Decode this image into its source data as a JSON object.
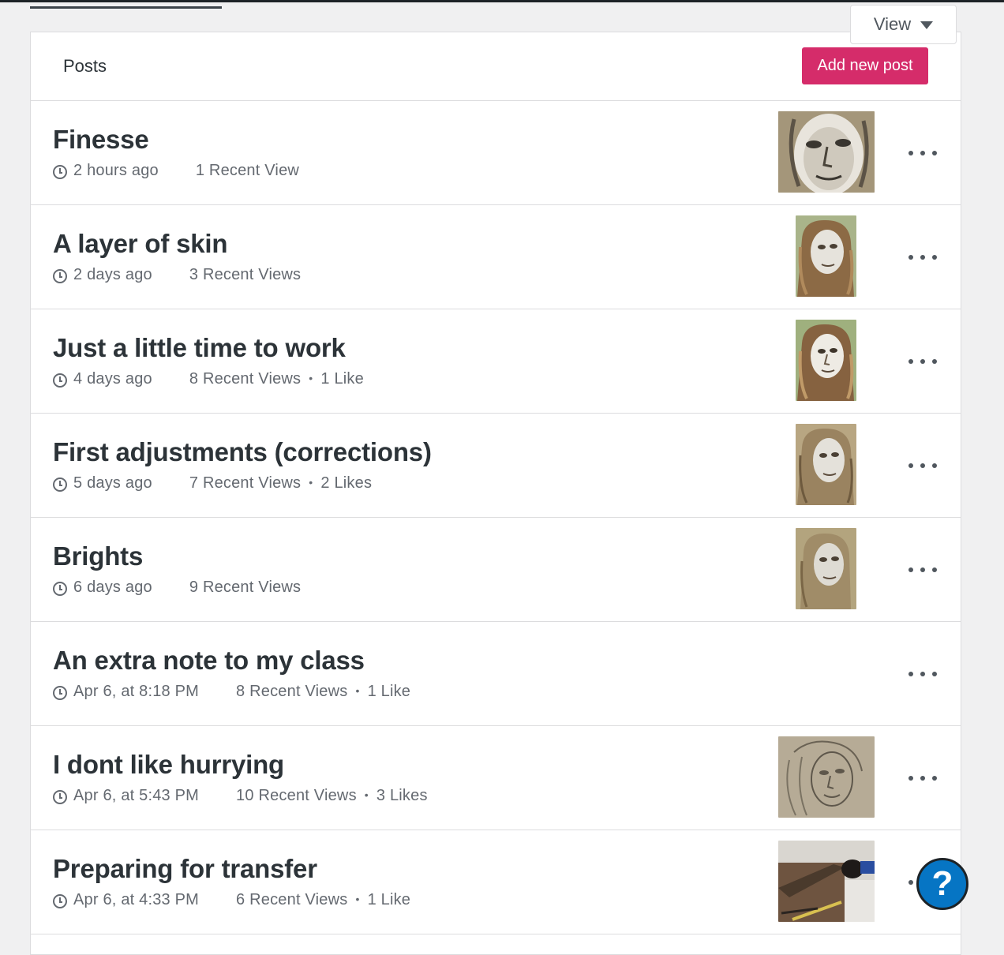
{
  "header": {
    "view_label": "View",
    "panel_title": "Posts",
    "add_button": "Add new post"
  },
  "posts": [
    {
      "title": "Finesse",
      "time": "2 hours ago",
      "views": "1 Recent View",
      "likes": "",
      "thumbnail": "portrait-charcoal-closeup"
    },
    {
      "title": "A layer of skin",
      "time": "2 days ago",
      "views": "3 Recent Views",
      "likes": "",
      "thumbnail": "portrait-green-ground"
    },
    {
      "title": "Just a little time to work",
      "time": "4 days ago",
      "views": "8 Recent Views",
      "likes": "1 Like",
      "thumbnail": "portrait-green-ground"
    },
    {
      "title": "First adjustments (corrections)",
      "time": "5 days ago",
      "views": "7 Recent Views",
      "likes": "2 Likes",
      "thumbnail": "portrait-sepia"
    },
    {
      "title": "Brights",
      "time": "6 days ago",
      "views": "9 Recent Views",
      "likes": "",
      "thumbnail": "portrait-sepia"
    },
    {
      "title": "An extra note to my class",
      "time": "Apr 6, at 8:18 PM",
      "views": "8 Recent Views",
      "likes": "1 Like",
      "thumbnail": ""
    },
    {
      "title": "I dont like hurrying",
      "time": "Apr 6, at 5:43 PM",
      "views": "10 Recent Views",
      "likes": "3 Likes",
      "thumbnail": "pencil-sketch-portrait"
    },
    {
      "title": "Preparing for transfer",
      "time": "Apr 6, at 4:33 PM",
      "views": "6 Recent Views",
      "likes": "1 Like",
      "thumbnail": "art-supplies-photo"
    }
  ],
  "help": {
    "label": "?"
  },
  "colors": {
    "accent": "#d52c6a",
    "help": "#0675c4"
  }
}
